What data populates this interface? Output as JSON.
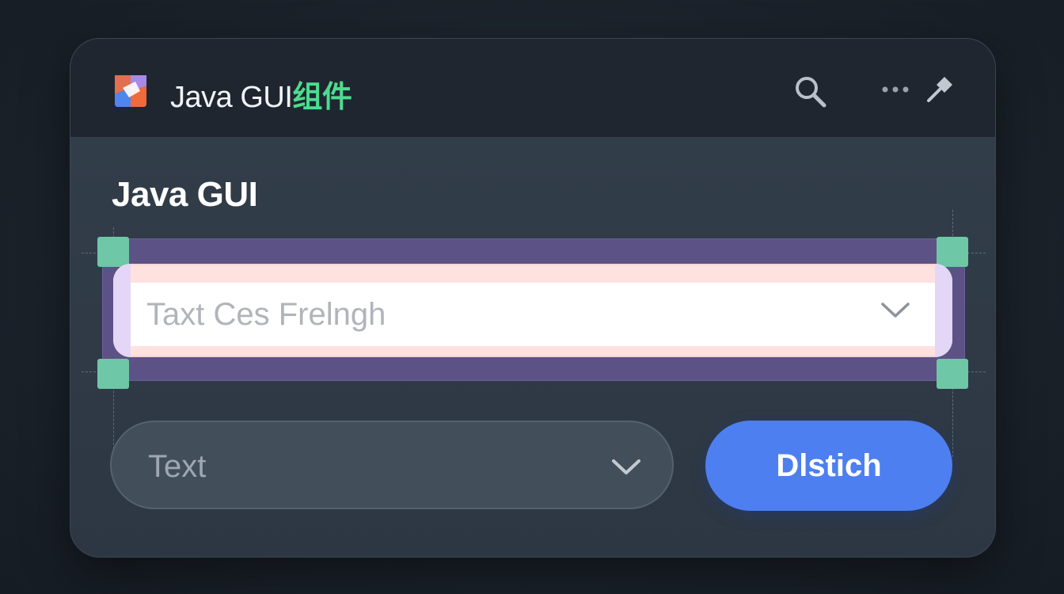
{
  "window": {
    "title_prefix": "Java GUI",
    "title_accent": "组件"
  },
  "titlebar": {
    "icons": [
      "app-logo-icon",
      "search-icon",
      "more-horizontal-icon",
      "pin-icon"
    ]
  },
  "section": {
    "title": "Java GUI"
  },
  "combo_primary": {
    "value": "Taxt Ces Frelngh",
    "icon": "chevron-down-icon",
    "selected": true
  },
  "combo_secondary": {
    "value": "Text",
    "icon": "chevron-down-icon"
  },
  "action_button": {
    "label": "Dlstich"
  },
  "colors": {
    "window_bg": "#2f3945",
    "titlebar_bg": "#1f2630",
    "accent_green": "#4ddc8f",
    "selection_frame": "#5d5285",
    "selection_handle": "#6ec7a6",
    "primary_button": "#4d7ff0"
  }
}
